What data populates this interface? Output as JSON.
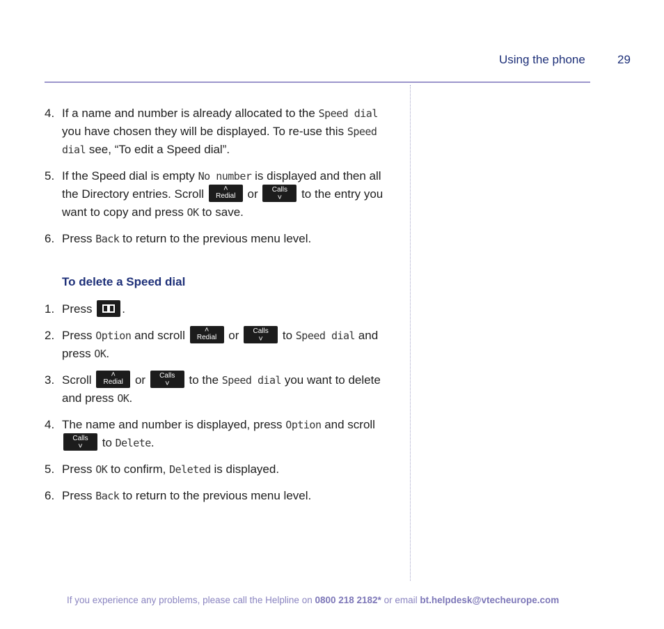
{
  "header": {
    "section_title": "Using the phone",
    "page_number": "29"
  },
  "colors": {
    "heading_blue": "#1d2f78",
    "rule_lavender": "#9b95cc",
    "footer_text": "#8a84c0",
    "key_background": "#1c1c1c"
  },
  "keys": {
    "redial_label": "Redial",
    "calls_label": "Calls",
    "up_chevron": "^",
    "down_chevron": "v"
  },
  "steps_top": [
    {
      "number": "4.",
      "parts": {
        "a": "If a name and number is already allocated to the ",
        "b": "Speed dial",
        "c": " you have chosen they will be displayed. To re-use this ",
        "d": "Speed dial",
        "e": " see, “To edit a Speed dial”."
      }
    },
    {
      "number": "5.",
      "parts": {
        "a": "If the Speed dial is empty ",
        "b": "No number",
        "c": " is displayed and then all the Directory entries. Scroll ",
        "d": " or ",
        "e": " to the entry you want to copy and press ",
        "f": "OK",
        "g": " to save."
      }
    },
    {
      "number": "6.",
      "parts": {
        "a": "Press ",
        "b": "Back",
        "c": " to return to the previous menu level."
      }
    }
  ],
  "delete_section": {
    "heading": "To delete a Speed dial",
    "steps": [
      {
        "number": "1.",
        "parts": {
          "a": "Press ",
          "b": "."
        }
      },
      {
        "number": "2.",
        "parts": {
          "a": "Press ",
          "b": "Option",
          "c": " and scroll ",
          "d": " or ",
          "e": " to ",
          "f": "Speed dial",
          "g": " and press ",
          "h": "OK",
          "i": "."
        }
      },
      {
        "number": "3.",
        "parts": {
          "a": "Scroll ",
          "b": " or ",
          "c": " to the ",
          "d": "Speed dial",
          "e": " you want to delete and press ",
          "f": "OK",
          "g": "."
        }
      },
      {
        "number": "4.",
        "parts": {
          "a": "The name and number is displayed, press ",
          "b": "Option",
          "c": " and scroll ",
          "d": " to ",
          "e": "Delete",
          "f": "."
        }
      },
      {
        "number": "5.",
        "parts": {
          "a": "Press ",
          "b": "OK",
          "c": " to confirm, ",
          "d": "Deleted",
          "e": " is displayed."
        }
      },
      {
        "number": "6.",
        "parts": {
          "a": "Press ",
          "b": "Back",
          "c": " to return to the previous menu level."
        }
      }
    ]
  },
  "footer": {
    "text_before": "If you experience any problems, please call the Helpline on ",
    "phone": "0800 218 2182*",
    "text_middle": " or email ",
    "email": "bt.helpdesk@vtecheurope.com"
  }
}
